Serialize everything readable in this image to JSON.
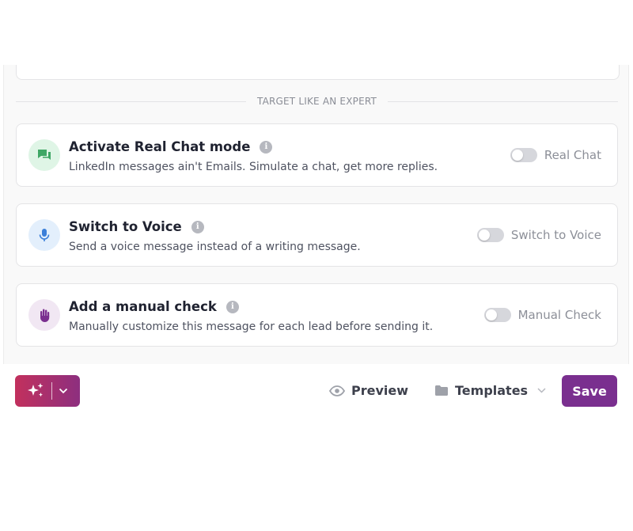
{
  "section": {
    "divider_text": "TARGET LIKE AN EXPERT"
  },
  "cards": [
    {
      "title": "Activate Real Chat mode",
      "description": "LinkedIn messages ain't Emails. Simulate a chat, get more replies.",
      "toggle_label": "Real Chat",
      "toggle_on": false,
      "icon": "chat-bubbles-icon",
      "icon_bg": "#dff5e6",
      "icon_color": "#3fa765"
    },
    {
      "title": "Switch to Voice",
      "description": "Send a voice message instead of a writing message.",
      "toggle_label": "Switch to Voice",
      "toggle_on": false,
      "icon": "microphone-icon",
      "icon_bg": "#e3effc",
      "icon_color": "#3b7fd9"
    },
    {
      "title": "Add a manual check",
      "description": "Manually customize this message for each lead before sending it.",
      "toggle_label": "Manual Check",
      "toggle_on": false,
      "icon": "hand-icon",
      "icon_bg": "#f1e7f3",
      "icon_color": "#7a2f8f"
    }
  ],
  "info_glyph": "i",
  "footer": {
    "ai_button_icon": "sparkles-icon",
    "preview_label": "Preview",
    "templates_label": "Templates",
    "save_label": "Save"
  },
  "colors": {
    "brand_purple": "#7a2f8f",
    "ai_gradient_start": "#c2305d",
    "ai_gradient_end": "#8d2f7f"
  }
}
